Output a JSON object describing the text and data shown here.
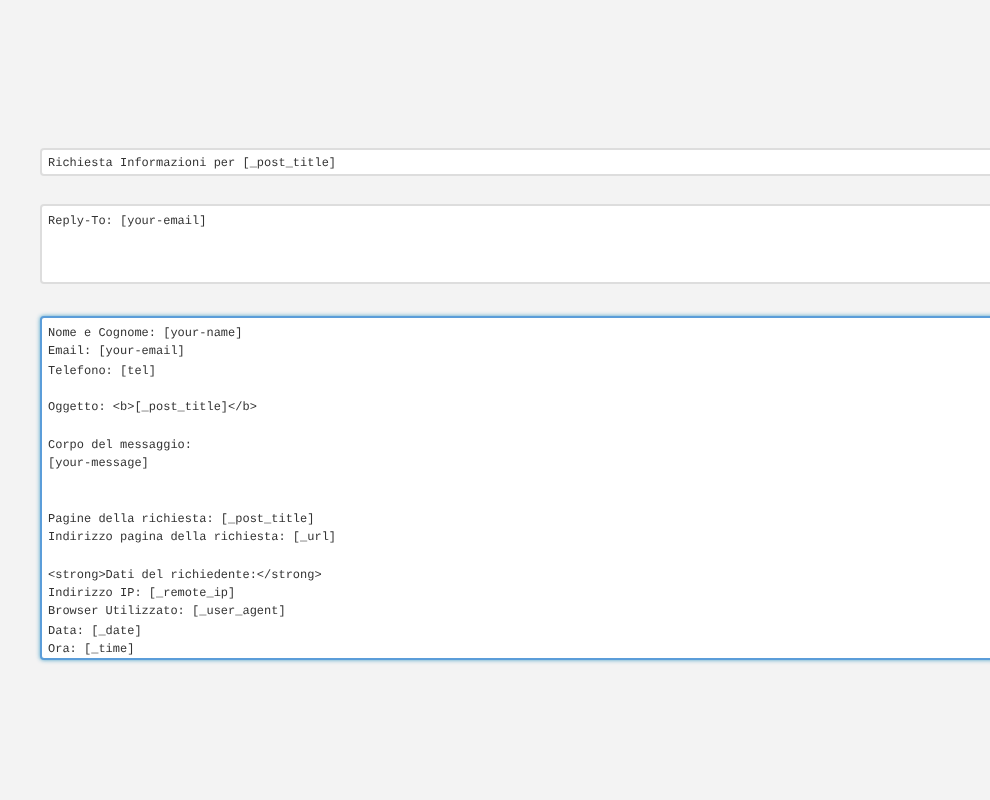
{
  "subject_field": {
    "value": "Richiesta Informazioni per [_post_title]",
    "focused": false
  },
  "headers_field": {
    "value": "Reply-To: [your-email]",
    "focused": false
  },
  "body_field": {
    "value": "Nome e Cognome: [your-name]\nEmail: [your-email]\nTelefono: [tel]\n\nOggetto: <b>[_post_title]</b>\n\nCorpo del messaggio:\n[your-message]\n\n\nPagine della richiesta: [_post_title]\nIndirizzo pagina della richiesta: [_url]\n\n<strong>Dati del richiedente:</strong>\nIndirizzo IP: [_remote_ip]\nBrowser Utilizzato: [_user_agent]\nData: [_date]\nOra: [_time]",
    "focused": true
  }
}
